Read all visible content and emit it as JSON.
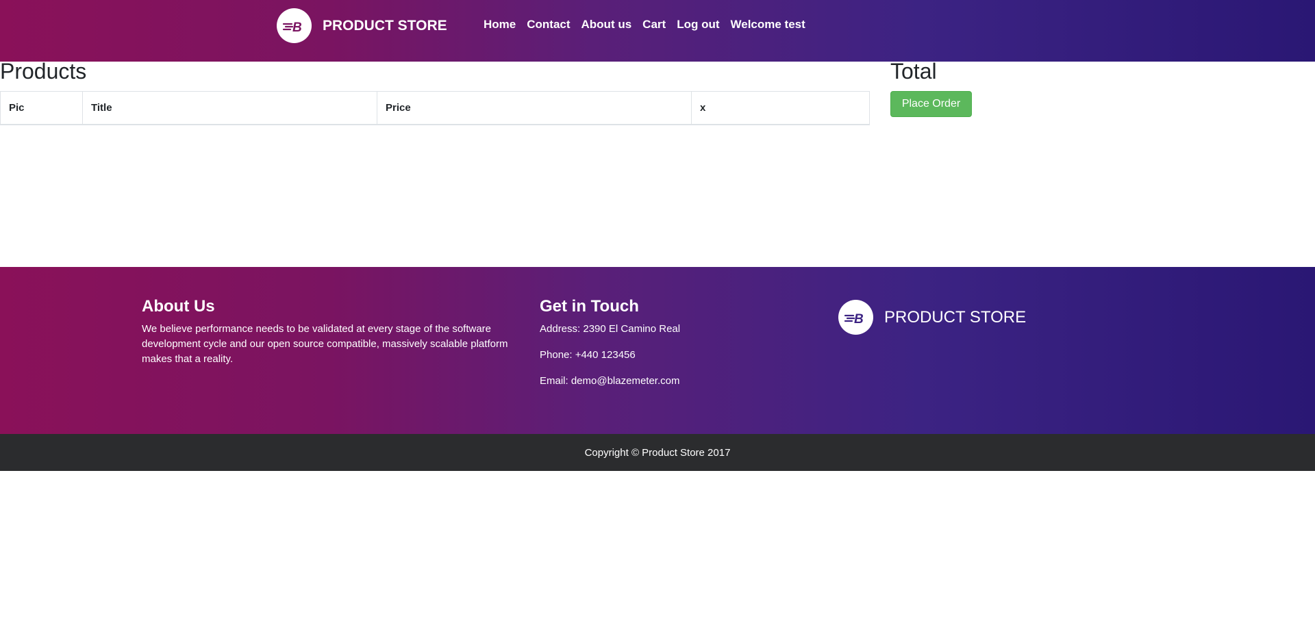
{
  "header": {
    "brand": "PRODUCT STORE",
    "logo_icon": "blazemeter-b-logo-icon",
    "nav": [
      "Home",
      "Contact",
      "About us",
      "Cart",
      "Log out",
      "Welcome test"
    ]
  },
  "cart": {
    "title": "Products",
    "columns": [
      "Pic",
      "Title",
      "Price",
      "x"
    ],
    "total_title": "Total",
    "place_order": "Place Order"
  },
  "footer": {
    "about_title": "About Us",
    "about_text": "We believe performance needs to be validated at every stage of the software development cycle and our open source compatible, massively scalable platform makes that a reality.",
    "contact_title": "Get in Touch",
    "address": "Address: 2390 El Camino Real",
    "phone": "Phone: +440 123456",
    "email": "Email: demo@blazemeter.com",
    "brand": "PRODUCT STORE",
    "copyright": "Copyright © Product Store 2017"
  },
  "colors": {
    "gradient_start": "#8a1159",
    "gradient_end": "#2a1774",
    "button_green": "#5cb85c",
    "copyright_bg": "#2b2c2e"
  }
}
